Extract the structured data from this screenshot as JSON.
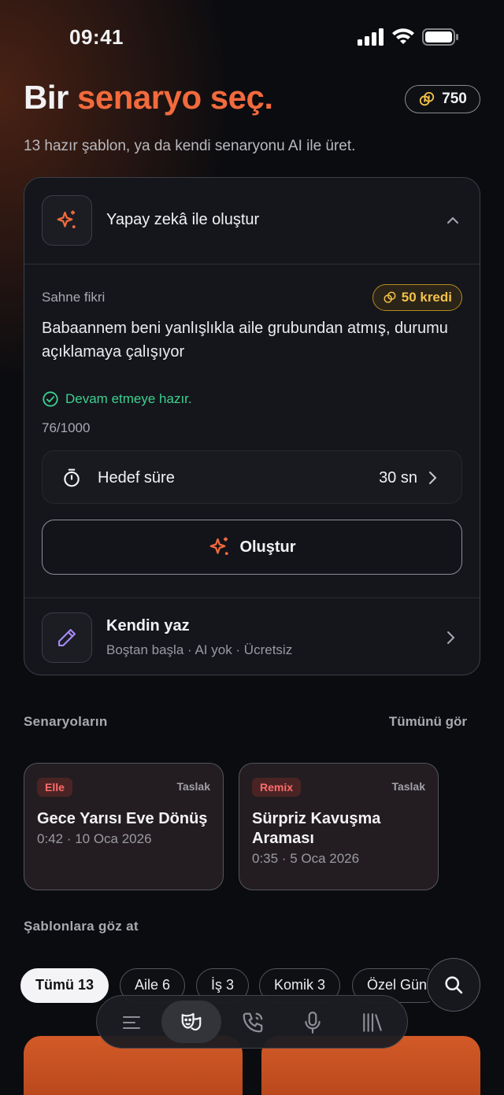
{
  "status_bar": {
    "time": "09:41"
  },
  "header": {
    "title_plain": "Bir",
    "title_accent": "senaryo seç.",
    "credits": "750",
    "subtitle": "13 hazır şablon, ya da kendi senaryonu AI ile üret."
  },
  "ai_card": {
    "heading": "Yapay zekâ ile oluştur",
    "scene_label": "Sahne fikri",
    "cost": "50 kredi",
    "scene_text": "Babaannem beni yanlışlıkla aile grubundan atmış, durumu açıklamaya çalışıyor",
    "ready_text": "Devam etmeye hazır.",
    "char_count": "76/1000",
    "duration_label": "Hedef süre",
    "duration_value": "30 sn",
    "create_label": "Oluştur",
    "write_title": "Kendin yaz",
    "write_sub": "Boştan başla · AI yok · Ücretsiz"
  },
  "scenarios": {
    "title": "Senaryoların",
    "see_all": "Tümünü gör",
    "items": [
      {
        "badge": "Elle",
        "status": "Taslak",
        "title": "Gece Yarısı Eve Dönüş",
        "meta": "0:42 · 10 Oca 2026"
      },
      {
        "badge": "Remix",
        "status": "Taslak",
        "title": "Sürpriz Kavuşma Araması",
        "meta": "0:35 · 5 Oca 2026"
      }
    ]
  },
  "templates": {
    "title": "Şablonlara göz at",
    "chips": [
      "Tümü 13",
      "Aile 6",
      "İş 3",
      "Komik 3",
      "Özel Gün"
    ]
  },
  "colors": {
    "accent": "#f26a3d",
    "success": "#3ed08f",
    "gold": "#f2c14a",
    "badge_red": "#ff6b6b"
  },
  "tab_bar": {
    "icons": [
      "list-icon",
      "theater-masks-icon",
      "phone-icon",
      "microphone-icon",
      "library-icon"
    ],
    "active": "theater-masks-icon"
  }
}
